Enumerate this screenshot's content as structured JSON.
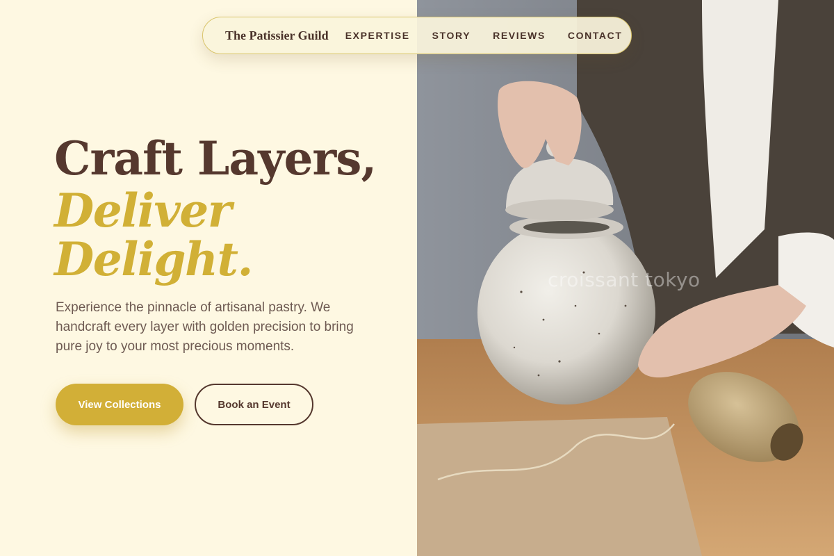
{
  "nav": {
    "brand": "The Patissier Guild",
    "links": [
      {
        "label": "EXPERTISE"
      },
      {
        "label": "STORY"
      },
      {
        "label": "REVIEWS"
      },
      {
        "label": "CONTACT"
      }
    ]
  },
  "hero": {
    "headline_line1": "Craft Layers,",
    "headline_line2": "Deliver",
    "headline_line3": "Delight.",
    "description": "Experience the pinnacle of artisanal pastry. We handcraft every layer with golden precision to bring pure joy to your most precious moments.",
    "primary_button": "View Collections",
    "secondary_button": "Book an Event"
  },
  "photo": {
    "subject": "hands lifting the lid of a speckled ceramic jar next to a spool of twine",
    "watermark": "croissant tokyo"
  },
  "colors": {
    "background": "#FEF8E2",
    "brown": "#55382E",
    "gold": "#D1B036",
    "body_text": "#6E5A52"
  }
}
